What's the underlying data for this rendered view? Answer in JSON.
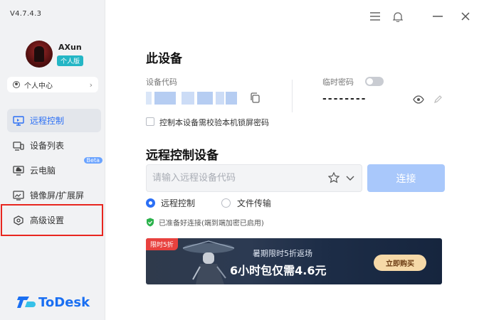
{
  "app": {
    "version": "V4.7.4.3",
    "brand": "ToDesk",
    "accent_color": "#2b6ff5"
  },
  "window_controls": [
    {
      "icon": "menu-icon"
    },
    {
      "icon": "bell-icon"
    },
    {
      "icon": "minimize-icon"
    },
    {
      "icon": "close-icon"
    }
  ],
  "user": {
    "name": "AXun",
    "plan": "个人版",
    "personal_center": "个人中心"
  },
  "nav": {
    "items": [
      {
        "label": "远程控制",
        "icon": "monitor-icon",
        "active": true
      },
      {
        "label": "设备列表",
        "icon": "devices-icon",
        "active": false
      },
      {
        "label": "云电脑",
        "icon": "cloud-pc-icon",
        "active": false,
        "badge": "Beta"
      },
      {
        "label": "镜像屏/扩展屏",
        "icon": "mirror-screen-icon",
        "active": false
      },
      {
        "label": "高级设置",
        "icon": "settings-icon",
        "active": false
      }
    ]
  },
  "this_device": {
    "title": "此设备",
    "device_code_label": "设备代码",
    "temp_password_label": "临时密码",
    "temp_password_value": "--------",
    "temp_password_toggle": false,
    "lock_checkbox_label": "控制本设备需校验本机锁屏密码",
    "lock_checkbox_checked": false
  },
  "remote_control": {
    "title": "远程控制设备",
    "input_placeholder": "请输入远程设备代码",
    "input_value": "",
    "connect_label": "连接",
    "modes": [
      {
        "label": "远程控制",
        "selected": true
      },
      {
        "label": "文件传输",
        "selected": false
      }
    ],
    "status": "已准备好连接(端到端加密已启用)"
  },
  "banner": {
    "tag": "限时5折",
    "subtitle": "暑期限时5折返场",
    "headline": "6小时包仅需4.6元",
    "button": "立即购买"
  }
}
